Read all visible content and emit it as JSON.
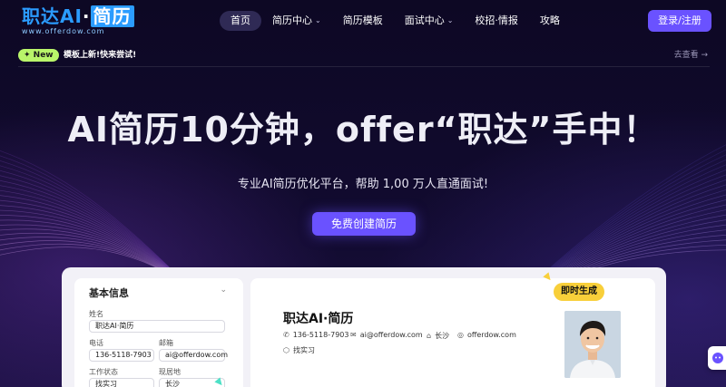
{
  "logo": {
    "main_a": "职达",
    "main_b": "AI",
    "main_c": "·",
    "main_d": "简历",
    "sub": "www.offerdow.com"
  },
  "nav": {
    "items": [
      {
        "label": "首页",
        "active": true,
        "has_dropdown": false
      },
      {
        "label": "简历中心",
        "active": false,
        "has_dropdown": true
      },
      {
        "label": "简历模板",
        "active": false,
        "has_dropdown": false
      },
      {
        "label": "面试中心",
        "active": false,
        "has_dropdown": true
      },
      {
        "label": "校招·情报",
        "active": false,
        "has_dropdown": false
      },
      {
        "label": "攻略",
        "active": false,
        "has_dropdown": false
      }
    ],
    "login_label": "登录/注册"
  },
  "announcement": {
    "badge": "✦ New",
    "text": "模板上新!快来尝试!",
    "link": "去查看 →"
  },
  "hero": {
    "title": "AI简历10分钟，offer“职达”手中！",
    "subtitle": "专业AI简历优化平台，帮助 1,00 万人直通面试!",
    "cta": "免费创建简历"
  },
  "form": {
    "section_title": "基本信息",
    "name_label": "姓名",
    "name_value": "职达AI·简历",
    "phone_label": "电话",
    "phone_value": "136-5118-7903",
    "email_label": "邮箱",
    "email_value": "ai@offerdow.com",
    "status_label": "工作状态",
    "status_value": "找实习",
    "location_label": "现居地",
    "location_value": "长沙"
  },
  "resume": {
    "name": "职达AI·简历",
    "phone": "136-5118-7903",
    "email": "ai@offerdow.com",
    "location": "长沙",
    "website": "offerdow.com",
    "status": "找实习"
  },
  "instant_badge": "即时生成",
  "colors": {
    "accent": "#6a52ff",
    "badge_new": "#b9f56a",
    "instant": "#f8cf3a",
    "logo_blue": "#2b9cff"
  }
}
